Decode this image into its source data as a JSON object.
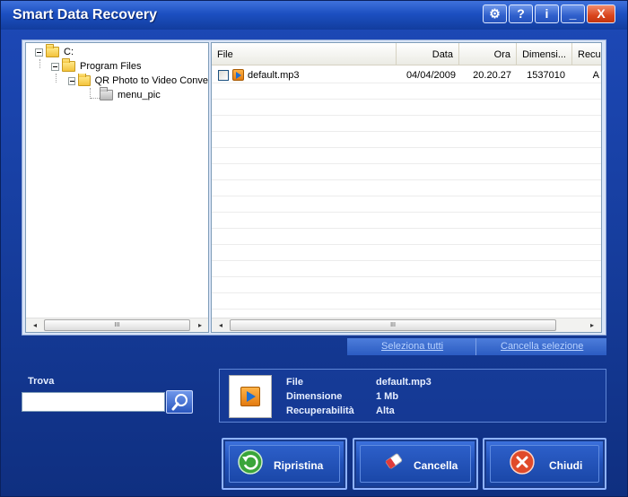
{
  "window": {
    "title": "Smart Data Recovery"
  },
  "titlebar_buttons": [
    {
      "name": "settings-button",
      "glyph": "⚙"
    },
    {
      "name": "help-button",
      "glyph": "?"
    },
    {
      "name": "info-button",
      "glyph": "i"
    },
    {
      "name": "minimize-button",
      "glyph": "_"
    },
    {
      "name": "close-button",
      "glyph": "X"
    }
  ],
  "tree": {
    "items": [
      {
        "label": "C:"
      },
      {
        "label": "Program Files"
      },
      {
        "label": "QR Photo to Video Conve"
      },
      {
        "label": "menu_pic"
      }
    ]
  },
  "file_list": {
    "columns": [
      "File",
      "Data",
      "Ora",
      "Dimensi...",
      "Recup"
    ],
    "rows": [
      {
        "file": "default.mp3",
        "data": "04/04/2009",
        "ora": "20.20.27",
        "dimensione": "1537010",
        "recup": "A"
      }
    ]
  },
  "scroll": {
    "thumb_glyph": "III",
    "left_arrow": "◂",
    "right_arrow": "▸"
  },
  "selection": {
    "select_all": "Seleziona tutti",
    "clear_selection": "Cancella selezione"
  },
  "search": {
    "label": "Trova",
    "value": ""
  },
  "details": {
    "file_label": "File",
    "file_value": "default.mp3",
    "size_label": "Dimensione",
    "size_value": "1 Mb",
    "recover_label": "Recuperabilità",
    "recover_value": "Alta"
  },
  "actions": {
    "restore": "Ripristina",
    "delete": "Cancella",
    "close": "Chiudi"
  },
  "colors": {
    "accent": "#1c4fc1",
    "link": "#b9d3ff",
    "restore_icon": "#3aa53a",
    "close_icon": "#e04a2a"
  }
}
